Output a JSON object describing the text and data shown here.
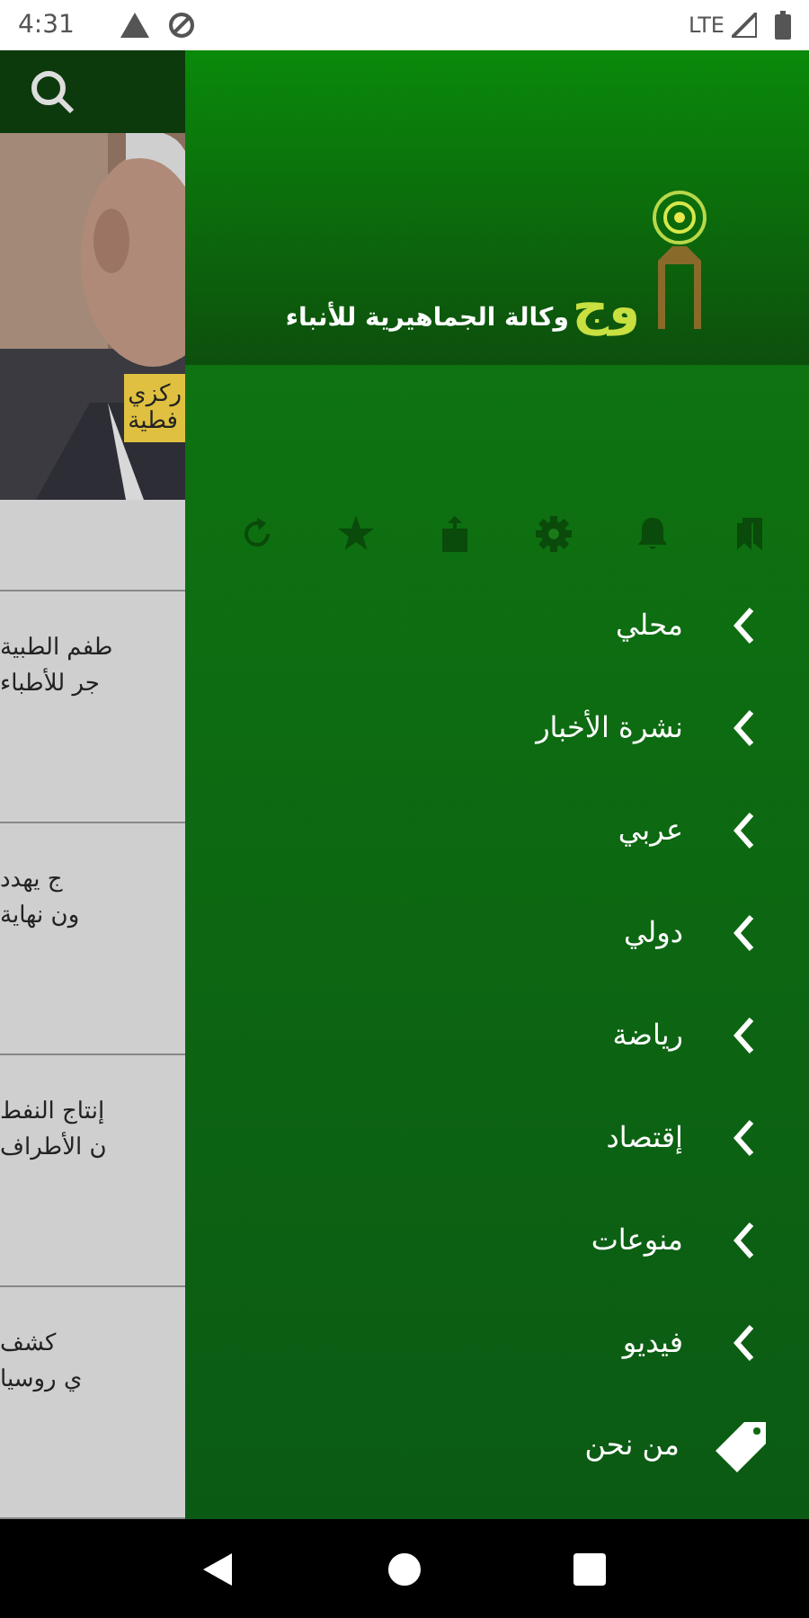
{
  "status_bar": {
    "time": "4:31",
    "network": "LTE"
  },
  "feed": {
    "photo_caption": [
      "ركزي",
      "فطية"
    ],
    "articles": [
      {
        "lines": [
          "طفم الطبية",
          "جر للأطباء"
        ]
      },
      {
        "lines": [
          "ج يهدد",
          "ون نهاية"
        ]
      },
      {
        "lines": [
          "إنتاج النفط",
          "ن الأطراف"
        ]
      },
      {
        "lines": [
          "كشف",
          "ي روسيا"
        ]
      }
    ]
  },
  "drawer": {
    "logo_mark": "وج",
    "logo_text": "وكالة الجماهيرية للأنباء",
    "menu": [
      {
        "label": "محلي",
        "kind": "section"
      },
      {
        "label": "نشرة الأخبار",
        "kind": "section"
      },
      {
        "label": "عربي",
        "kind": "section"
      },
      {
        "label": "دولي",
        "kind": "section"
      },
      {
        "label": "رياضة",
        "kind": "section"
      },
      {
        "label": "إقتصاد",
        "kind": "section"
      },
      {
        "label": "منوعات",
        "kind": "section"
      },
      {
        "label": "فيديو",
        "kind": "section"
      },
      {
        "label": "من نحن",
        "kind": "about"
      }
    ]
  }
}
